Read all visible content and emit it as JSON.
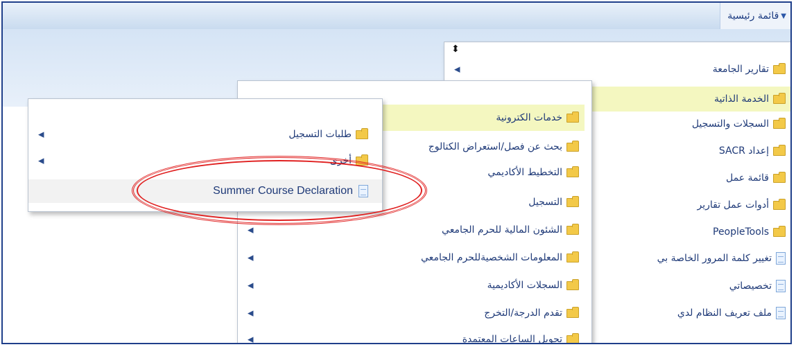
{
  "header": {
    "home_label": "قائمة رئيسية"
  },
  "menu_level1": {
    "items": [
      {
        "label": "تقارير الجامعة",
        "type": "folder",
        "has_sub": true
      },
      {
        "label": "الخدمة الذاتية",
        "type": "folder",
        "has_sub": false,
        "highlighted": true
      },
      {
        "label": "السجلات والتسجيل",
        "type": "folder",
        "has_sub": false
      },
      {
        "label": "إعداد SACR",
        "type": "folder",
        "has_sub": false
      },
      {
        "label": "قائمة عمل",
        "type": "folder",
        "has_sub": false
      },
      {
        "label": "أدوات عمل تقارير",
        "type": "folder",
        "has_sub": false
      },
      {
        "label": "PeopleTools",
        "type": "folder",
        "has_sub": false
      },
      {
        "label": "تغيير كلمة المرور الخاصة بي",
        "type": "doc",
        "has_sub": false
      },
      {
        "label": "تخصيصاتي",
        "type": "doc",
        "has_sub": false
      },
      {
        "label": "ملف تعريف النظام لدي",
        "type": "doc",
        "has_sub": false
      }
    ]
  },
  "menu_level2": {
    "items": [
      {
        "label": "خدمات الكترونية",
        "highlighted": true,
        "has_sub": false
      },
      {
        "label": "بحث عن فصل/استعراض الكتالوج",
        "has_sub": false
      },
      {
        "label": "التخطيط الأكاديمي",
        "has_sub": false
      },
      {
        "label": "التسجيل",
        "has_sub": false
      },
      {
        "label": "الشئون المالية للحرم الجامعي",
        "has_sub": true
      },
      {
        "label": "المعلومات الشخصيةللحرم الجامعي",
        "has_sub": true
      },
      {
        "label": "السجلات الأكاديمية",
        "has_sub": true
      },
      {
        "label": "تقدم الدرجة/التخرج",
        "has_sub": true
      },
      {
        "label": "تحويل الساعات المعتمدة",
        "has_sub": true
      }
    ]
  },
  "menu_level3": {
    "items": [
      {
        "label": "طلبات التسجيل",
        "type": "folder",
        "has_sub": true
      },
      {
        "label": "أخرى",
        "type": "folder",
        "has_sub": true
      },
      {
        "label": "Summer Course Declaration",
        "type": "doc",
        "has_sub": false,
        "selected": true
      }
    ]
  },
  "annotation": {
    "color": "#e02020"
  },
  "colors": {
    "highlight": "#f4f7c0",
    "link": "#1f3a78",
    "frame": "#1f3f8a"
  }
}
